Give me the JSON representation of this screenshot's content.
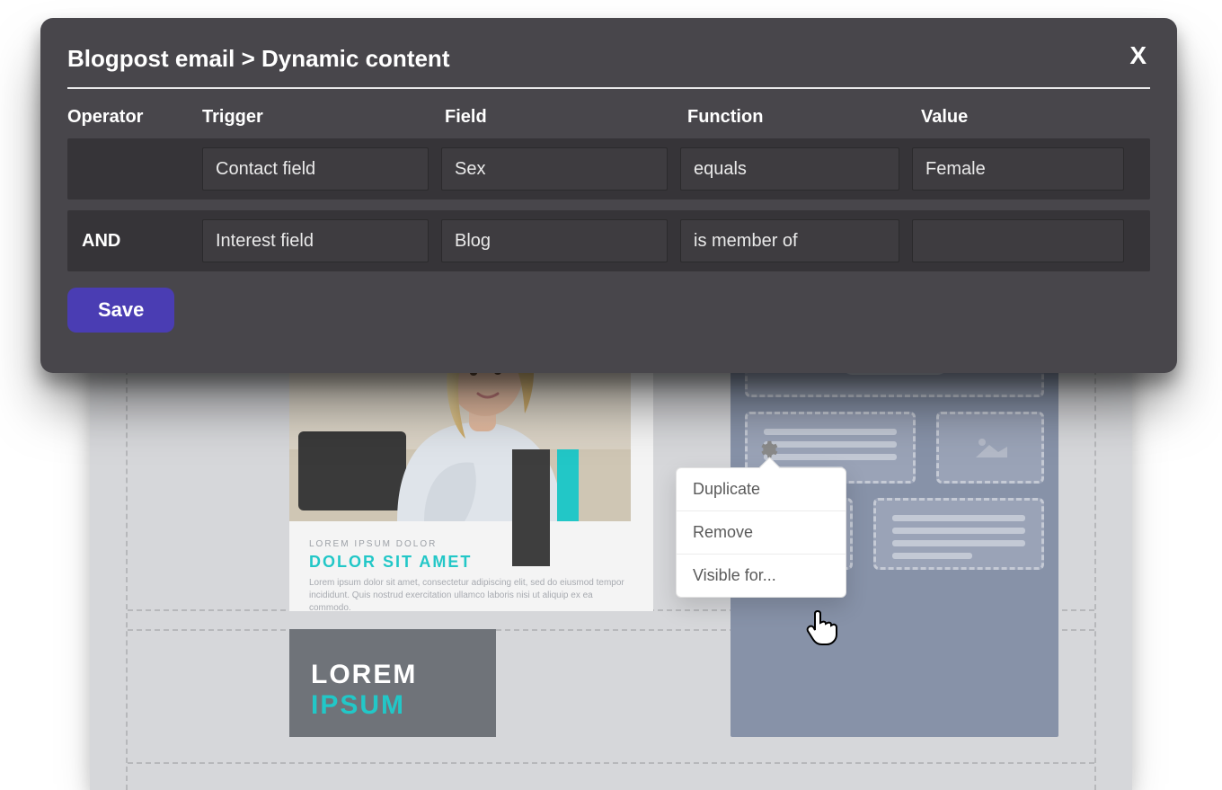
{
  "modal": {
    "breadcrumb": "Blogpost email > Dynamic content",
    "headers": {
      "operator": "Operator",
      "trigger": "Trigger",
      "field": "Field",
      "function": "Function",
      "value": "Value"
    },
    "rules": [
      {
        "operator": "",
        "trigger": "Contact field",
        "field": "Sex",
        "function": "equals",
        "value": "Female"
      },
      {
        "operator": "AND",
        "trigger": "Interest field",
        "field": "Blog",
        "function": "is member of",
        "value": ""
      }
    ],
    "save_label": "Save"
  },
  "popup": {
    "duplicate": "Duplicate",
    "remove": "Remove",
    "visible_for": "Visible for..."
  },
  "card": {
    "title_top": "LOREM IPSUM DOLOR",
    "sub_top": "Lorem ipsum dolor sit amet, consectetur",
    "caption_sm": "LOREM IPSUM DOLOR",
    "caption_lg": "DOLOR SIT AMET",
    "body": "Lorem ipsum dolor sit amet, consectetur adipiscing elit, sed do eiusmod tempor incididunt. Quis nostrud exercitation ullamco laboris nisi ut aliquip ex ea commodo."
  },
  "lorem_block": {
    "line1": "LOREM",
    "line2": "IPSUM"
  }
}
